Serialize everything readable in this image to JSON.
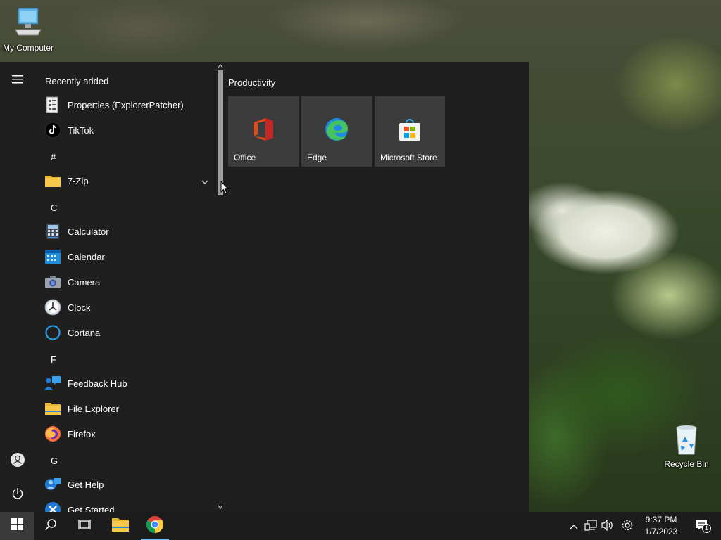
{
  "desktop": {
    "icons": [
      {
        "label": "My Computer",
        "icon": "computer-icon"
      },
      {
        "label": "Recycle Bin",
        "icon": "recycle-bin-icon"
      }
    ]
  },
  "start_menu": {
    "rail": {
      "menu_icon": "hamburger-icon",
      "user_icon": "user-icon",
      "power_icon": "power-icon"
    },
    "recently_added_label": "Recently added",
    "recently_added": [
      {
        "label": "Properties (ExplorerPatcher)",
        "icon": "properties-icon"
      },
      {
        "label": "TikTok",
        "icon": "tiktok-icon"
      }
    ],
    "groups": [
      {
        "letter": "#",
        "apps": [
          {
            "label": "7-Zip",
            "icon": "folder-icon",
            "expandable": true
          }
        ]
      },
      {
        "letter": "C",
        "apps": [
          {
            "label": "Calculator",
            "icon": "calculator-icon"
          },
          {
            "label": "Calendar",
            "icon": "calendar-icon"
          },
          {
            "label": "Camera",
            "icon": "camera-icon"
          },
          {
            "label": "Clock",
            "icon": "clock-icon"
          },
          {
            "label": "Cortana",
            "icon": "cortana-icon"
          }
        ]
      },
      {
        "letter": "F",
        "apps": [
          {
            "label": "Feedback Hub",
            "icon": "feedback-hub-icon"
          },
          {
            "label": "File Explorer",
            "icon": "file-explorer-icon"
          },
          {
            "label": "Firefox",
            "icon": "firefox-icon"
          }
        ]
      },
      {
        "letter": "G",
        "apps": [
          {
            "label": "Get Help",
            "icon": "get-help-icon"
          },
          {
            "label": "Get Started",
            "icon": "get-started-icon"
          }
        ]
      }
    ],
    "tile_group": {
      "title": "Productivity",
      "tiles": [
        {
          "label": "Office",
          "icon": "office-icon"
        },
        {
          "label": "Edge",
          "icon": "edge-icon"
        },
        {
          "label": "Microsoft Store",
          "icon": "store-icon"
        }
      ]
    }
  },
  "taskbar": {
    "buttons": [
      "start-icon",
      "search-icon",
      "task-view-icon",
      "file-explorer-icon",
      "chrome-icon"
    ],
    "tray": [
      "chevron-up-icon",
      "network-icon",
      "volume-icon",
      "settings-icon"
    ],
    "time": "9:37 PM",
    "date": "1/7/2023",
    "notification_count": "1"
  },
  "colors": {
    "menu_bg": "#1f1f1f",
    "tile_bg": "#3b3b3b",
    "taskbar_bg": "#1c1c1c",
    "accent": "#76b9ed"
  }
}
